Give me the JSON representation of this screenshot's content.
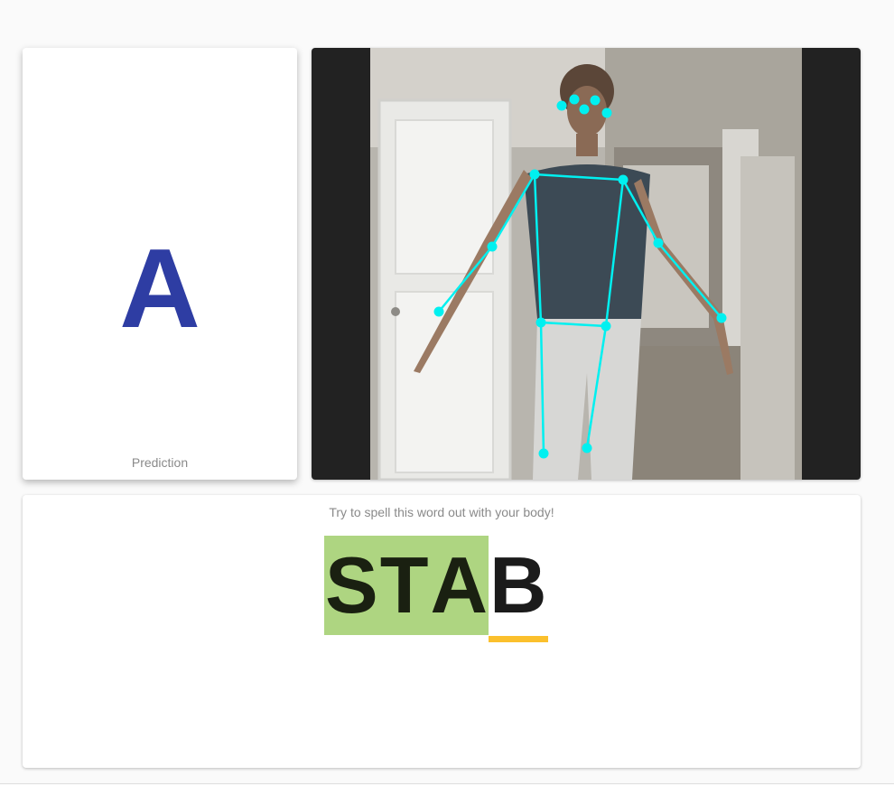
{
  "prediction": {
    "letter": "A",
    "caption": "Prediction",
    "color": "#2e3da3"
  },
  "camera": {
    "feed_icon": "person-pose-skeleton",
    "keypoint_color": "#00f0f0"
  },
  "challenge": {
    "instruction": "Try to spell this word out with your body!",
    "letters": [
      "S",
      "T",
      "A",
      "B"
    ],
    "completed_count": 3,
    "completed_color": "#aed581",
    "current_underline_color": "#fbc02d"
  }
}
